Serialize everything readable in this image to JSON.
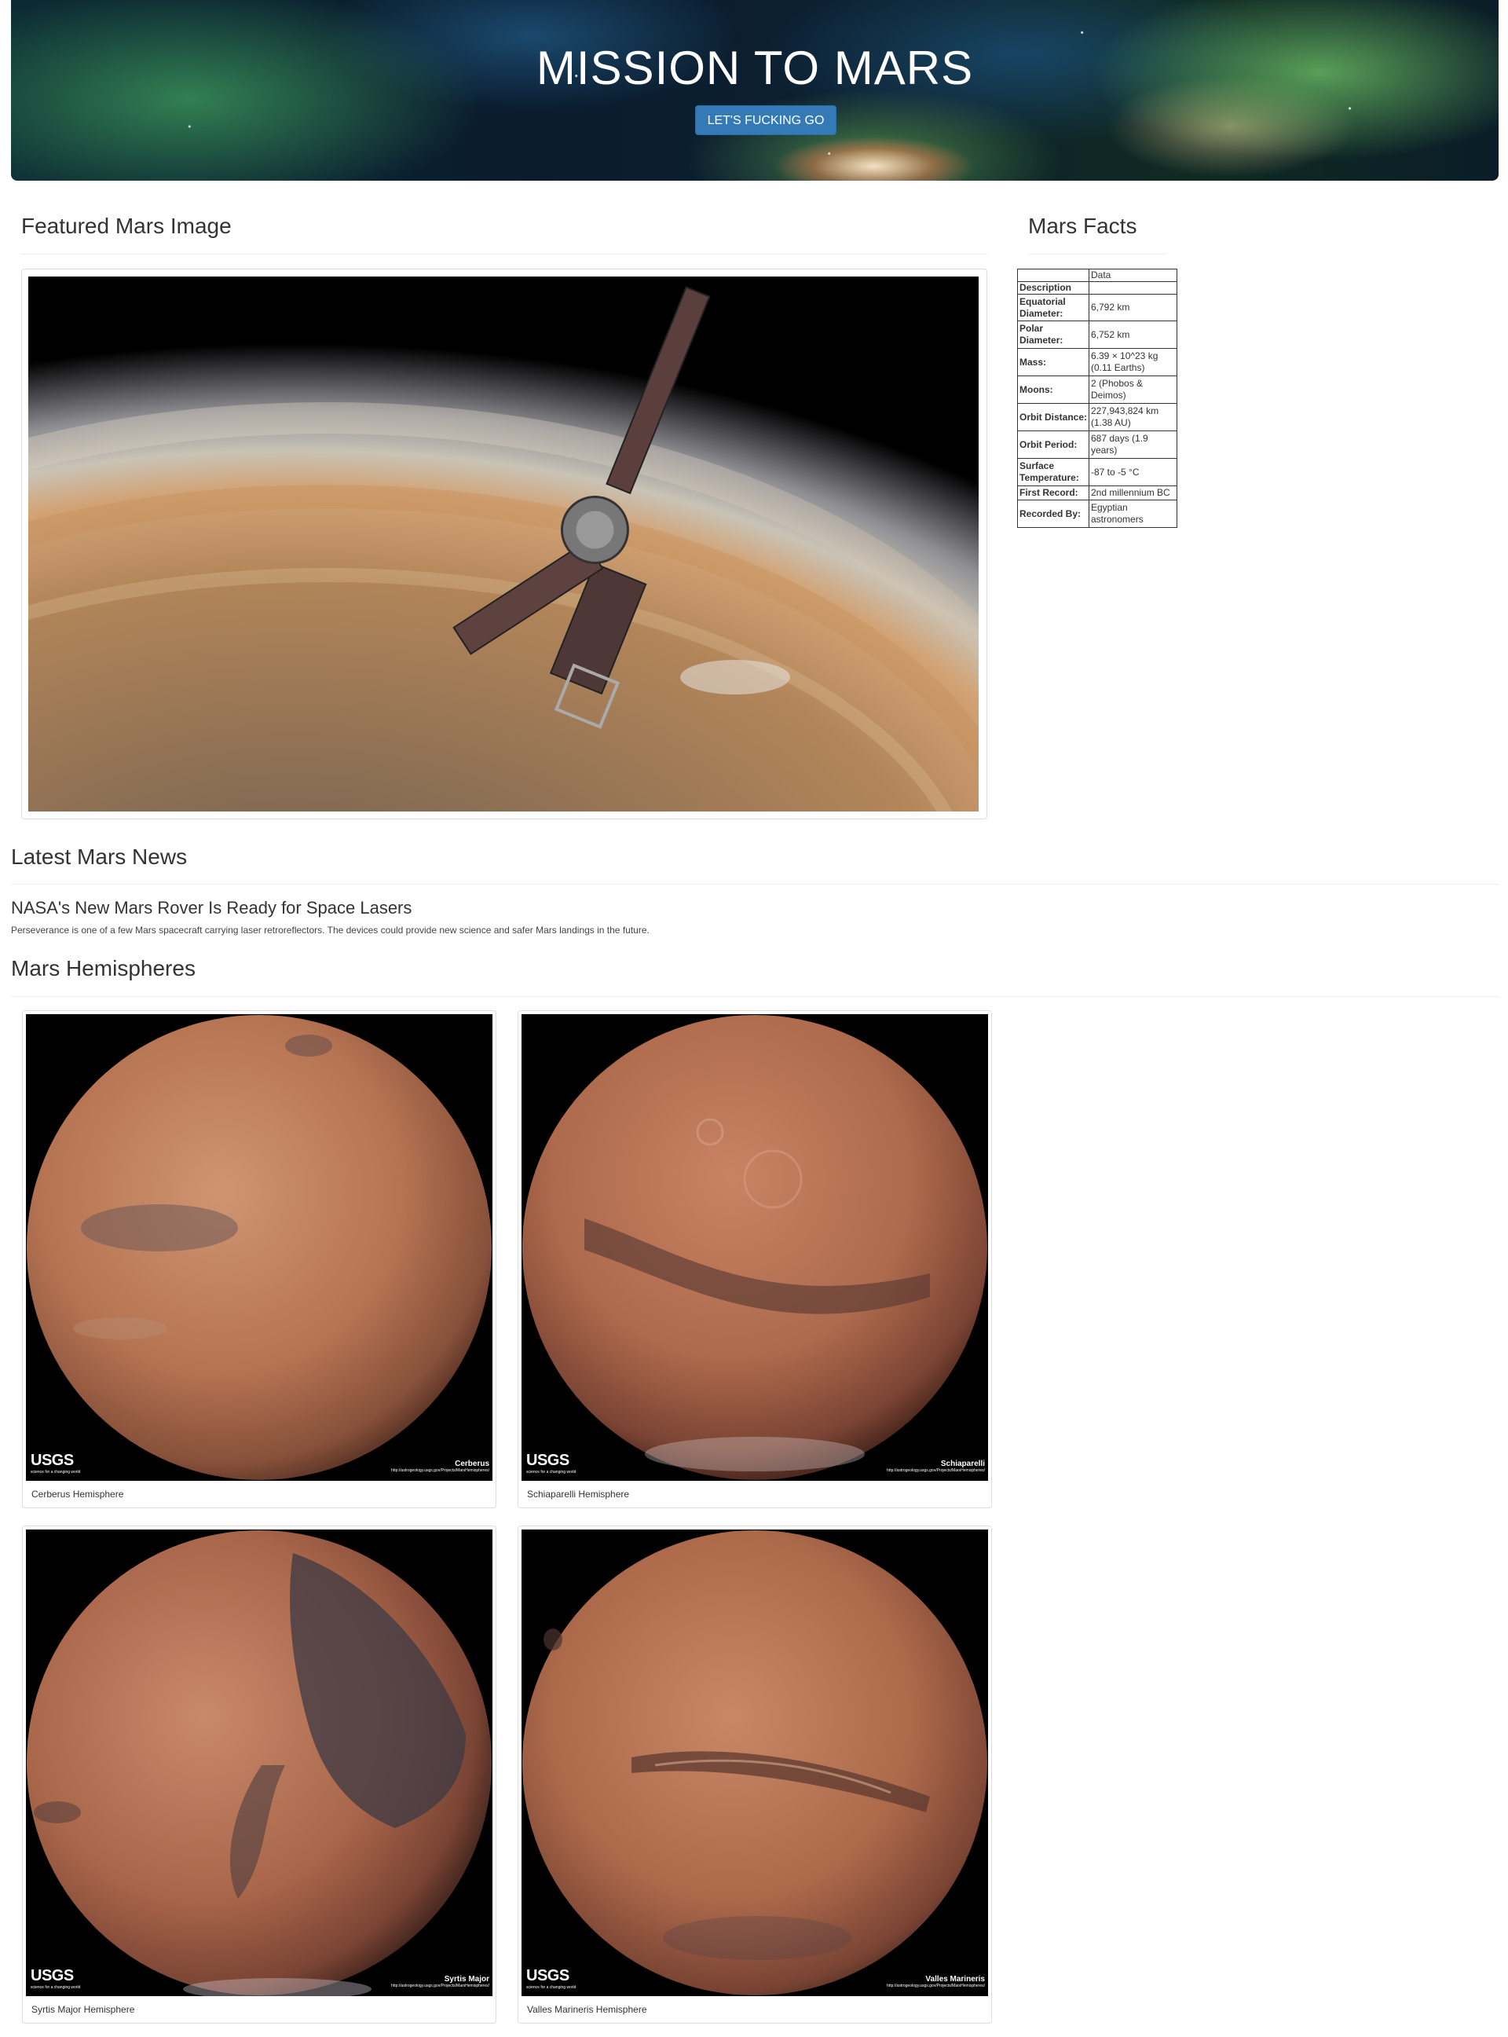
{
  "header": {
    "title": "MISSION TO MARS",
    "button_label": "LET'S FUCKING GO"
  },
  "featured": {
    "heading": "Featured Mars Image"
  },
  "facts": {
    "heading": "Mars Facts",
    "column_header": "Data",
    "index_header": "Description",
    "rows": [
      {
        "label": "Equatorial Diameter:",
        "value": "6,792 km"
      },
      {
        "label": "Polar Diameter:",
        "value": "6,752 km"
      },
      {
        "label": "Mass:",
        "value": "6.39 × 10^23 kg (0.11 Earths)"
      },
      {
        "label": "Moons:",
        "value": "2 (Phobos & Deimos)"
      },
      {
        "label": "Orbit Distance:",
        "value": "227,943,824 km (1.38 AU)"
      },
      {
        "label": "Orbit Period:",
        "value": "687 days (1.9 years)"
      },
      {
        "label": "Surface Temperature:",
        "value": "-87 to -5 °C"
      },
      {
        "label": "First Record:",
        "value": "2nd millennium BC"
      },
      {
        "label": "Recorded By:",
        "value": "Egyptian astronomers"
      }
    ]
  },
  "news": {
    "heading": "Latest Mars News",
    "title": "NASA's New Mars Rover Is Ready for Space Lasers",
    "paragraph": "Perseverance is one of a few Mars spacecraft carrying laser retroreflectors. The devices could provide new science and safer Mars landings in the future."
  },
  "hemispheres": {
    "heading": "Mars Hemispheres",
    "items": [
      {
        "caption": "Cerberus Hemisphere",
        "image_label": "Cerberus"
      },
      {
        "caption": "Schiaparelli Hemisphere",
        "image_label": "Schiaparelli"
      },
      {
        "caption": "Syrtis Major Hemisphere",
        "image_label": "Syrtis Major"
      },
      {
        "caption": "Valles Marineris Hemisphere",
        "image_label": "Valles Marineris"
      }
    ],
    "usgs_logo": "USGS",
    "usgs_tagline": "science for a changing world",
    "credit_url": "http://astrogeology.usgs.gov/Projects/MarsHemispheres/"
  }
}
